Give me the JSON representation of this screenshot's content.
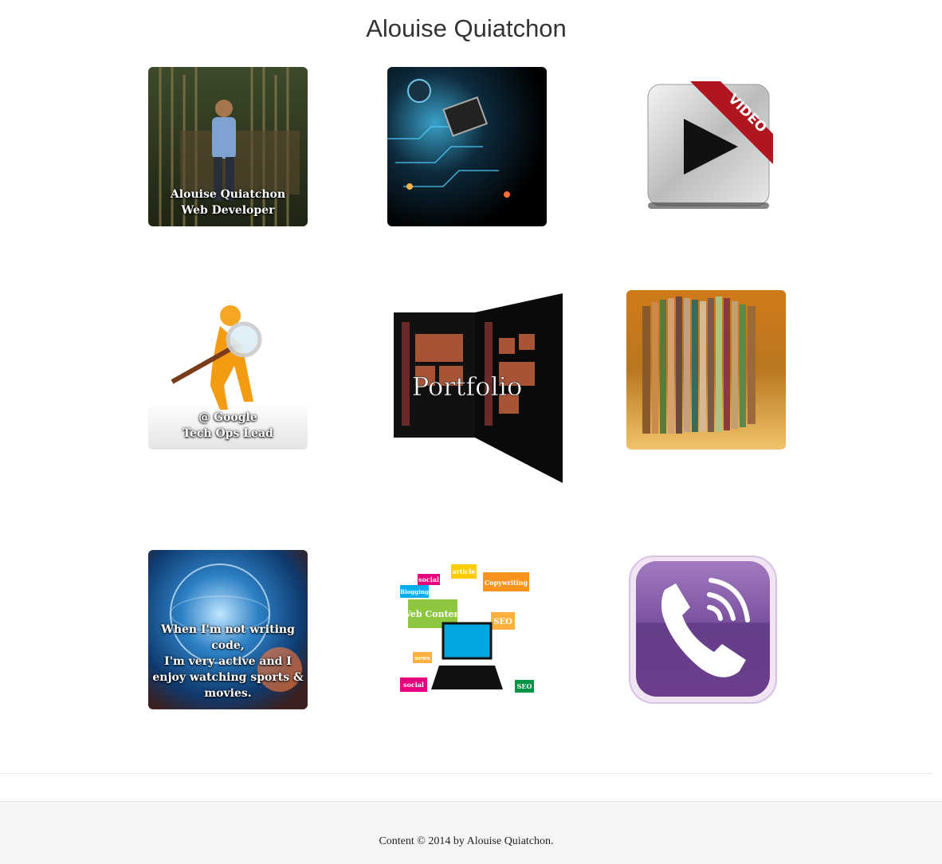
{
  "header": {
    "title": "Alouise Quiatchon"
  },
  "tiles": [
    {
      "name": "profile",
      "icon": "profile-photo",
      "lines": [
        "Alouise Quiatchon",
        "Web Developer"
      ]
    },
    {
      "name": "tech",
      "icon": "circuit-board-image",
      "lines": []
    },
    {
      "name": "video",
      "icon": "video-play-icon",
      "ribbon": "VIDEO",
      "lines": []
    },
    {
      "name": "google",
      "icon": "magnifier-figure-image",
      "lines": [
        "@ Google",
        "Tech Ops Lead"
      ]
    },
    {
      "name": "portfolio",
      "icon": "portfolio-book-image",
      "lines": [
        "Portfolio"
      ]
    },
    {
      "name": "album",
      "icon": "photo-album-image",
      "lines": []
    },
    {
      "name": "hobbies",
      "icon": "globe-image",
      "lines": [
        "When I'm not writing",
        "code,",
        "I'm very active and I",
        "enjoy watching sports &",
        "movies."
      ]
    },
    {
      "name": "web-content",
      "icon": "web-content-image",
      "words": [
        "social",
        "article",
        "Blogging",
        "Copywriting",
        "Web Content",
        "SEO",
        "news",
        "social",
        "SEO"
      ],
      "lines": []
    },
    {
      "name": "viber",
      "icon": "phone-icon",
      "lines": []
    }
  ],
  "footer": {
    "text": "Content © 2014 by Alouise Quiatchon."
  },
  "colors": {
    "accent": "#6b3e8c",
    "ribbon": "#b0161e",
    "footer_bg": "#f5f5f5"
  }
}
